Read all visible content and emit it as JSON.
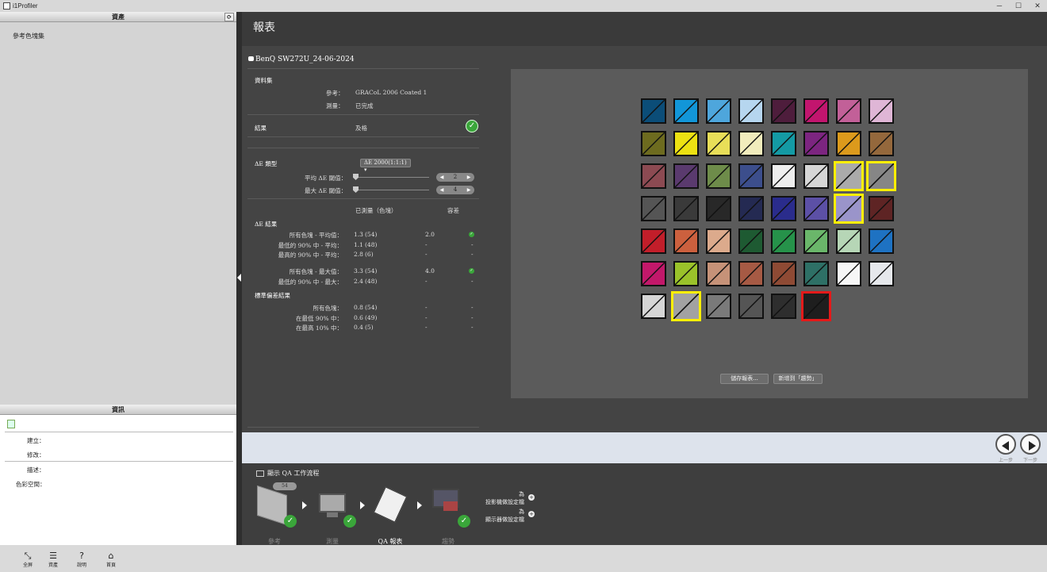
{
  "window": {
    "title": "i1Profiler",
    "controls": [
      "─",
      "☐",
      "✕"
    ]
  },
  "left_panel": {
    "assets_header": "資產",
    "asset_items": [
      "參考色塊集"
    ],
    "info_header": "資訊",
    "info_fields": {
      "created": "建立：",
      "modified": "修改：",
      "description": "描述：",
      "colorspace": "色彩空間："
    }
  },
  "header": {
    "title": "報表"
  },
  "report": {
    "device": "BenQ SW272U_24-06-2024",
    "dataset_title": "資料集",
    "reference_label": "參考：",
    "reference_value": "GRACoL 2006 Coated 1",
    "measurement_label": "測量：",
    "measurement_value": "已完成",
    "result_label": "結果",
    "result_value": "及格",
    "de_type_label": "ΔE 類型",
    "de_type_value": "ΔE 2000(1:1:1)",
    "avg_threshold_label": "平均 ΔE 閾值：",
    "avg_threshold_value": "2",
    "max_threshold_label": "最大 ΔE 閾值：",
    "max_threshold_value": "4",
    "col_measured": "已測量（色塊）",
    "col_tolerance": "容差",
    "de_results_title": "ΔE 結果",
    "rows_avg": [
      {
        "label": "所有色塊 - 平均值：",
        "value": "1.3",
        "count": "(54)",
        "tol": "2.0",
        "pass": true
      },
      {
        "label": "最低的 90% 中 - 平均：",
        "value": "1.1",
        "count": "(48)",
        "tol": "-",
        "pass": false
      },
      {
        "label": "最高的 90% 中 - 平均：",
        "value": "2.8",
        "count": "(6)",
        "tol": "-",
        "pass": false
      }
    ],
    "rows_max": [
      {
        "label": "所有色塊 - 最大值：",
        "value": "3.3",
        "count": "(54)",
        "tol": "4.0",
        "pass": true
      },
      {
        "label": "最低的 90% 中 - 最大：",
        "value": "2.4",
        "count": "(48)",
        "tol": "-",
        "pass": false
      }
    ],
    "std_title": "標準偏差結果",
    "rows_std": [
      {
        "label": "所有色塊：",
        "value": "0.8",
        "count": "(54)",
        "tol": "-",
        "flag": "-"
      },
      {
        "label": "在最低 90% 中：",
        "value": "0.6",
        "count": "(49)",
        "tol": "-",
        "flag": "-"
      },
      {
        "label": "在最高 10% 中：",
        "value": "0.4",
        "count": "(5)",
        "tol": "-",
        "flag": "-"
      }
    ],
    "save_report": "儲存報表...",
    "add_trend": "新增到「趨勢」"
  },
  "patches": [
    [
      "#0b4d78",
      "#1296d8",
      "#4ea6dc",
      "#b6d6ef",
      "#4e1d3c",
      "#c2156e",
      "#c26098",
      "#dfb6d6"
    ],
    [
      "#6d6b1f",
      "#ece112",
      "#e8de58",
      "#f1ecbc",
      "#149aa4",
      "#7c2580",
      "#dc9a1c",
      "#94683c"
    ],
    [
      "#8c4a52",
      "#5a3a6e",
      "#6e8c4a",
      "#3c4e8c",
      "#eeeeee",
      "#d6d6d6",
      "#aaaaaa",
      "#868686"
    ],
    [
      "#555555",
      "#3a3a3a",
      "#282828",
      "#242a52",
      "#2a2c8c",
      "#5c50a6",
      "#9a94ca",
      "#5e2424"
    ],
    [
      "#c21e2a",
      "#cc603e",
      "#dcaa8c",
      "#1e5a32",
      "#26924a",
      "#6ab66a",
      "#b6d6b6",
      "#1e72c2"
    ],
    [
      "#c2186a",
      "#9ac22a",
      "#c69278",
      "#a65a44",
      "#8e4a34",
      "#2e7066",
      "#f6f6f6",
      "#e6e8ec"
    ],
    [
      "#d6d6d6",
      "#a2a2a2",
      "#7a7a7a",
      "#555555",
      "#2e2e2e",
      "#1e1e1e"
    ]
  ],
  "highlights": {
    "yellow": [
      "2-6",
      "2-7",
      "3-6",
      "6-1"
    ],
    "red": [
      "6-5"
    ]
  },
  "nav": {
    "prev": "上一步",
    "next": "下一步"
  },
  "workflow": {
    "title": "顯示 QA 工作流程",
    "steps": [
      {
        "label": "參考"
      },
      {
        "label": "測量"
      },
      {
        "label": "QA 報表"
      },
      {
        "label": "趨勢"
      }
    ],
    "badge_count": "54",
    "opt1_a": "為",
    "opt1_b": "投影機做設定檔",
    "opt2_a": "為",
    "opt2_b": "顯示器做設定檔"
  },
  "toolbar": [
    {
      "icon": "⤡",
      "label": "全屏"
    },
    {
      "icon": "☰",
      "label": "資產"
    },
    {
      "icon": "?",
      "label": "說明"
    },
    {
      "icon": "⌂",
      "label": "首頁"
    }
  ]
}
